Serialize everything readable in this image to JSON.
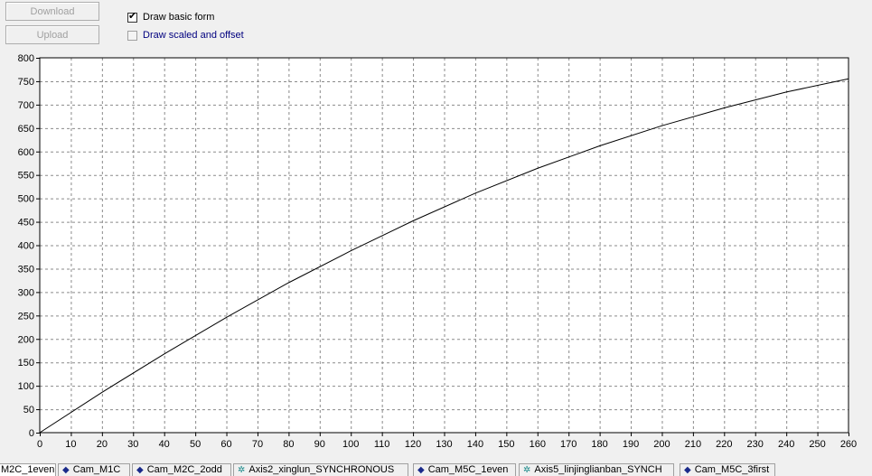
{
  "toolbar": {
    "download_label": "Download",
    "upload_label": "Upload"
  },
  "options": {
    "draw_basic": {
      "label": "Draw basic form",
      "checked": true,
      "check_glyph": "✔"
    },
    "draw_scaled": {
      "label": "Draw scaled and offset",
      "checked": false
    }
  },
  "chart_data": {
    "type": "line",
    "title": "",
    "xlabel": "",
    "ylabel": "",
    "xlim": [
      0,
      260
    ],
    "ylim": [
      0,
      800
    ],
    "x_ticks": [
      0,
      10,
      20,
      30,
      40,
      50,
      60,
      70,
      80,
      90,
      100,
      110,
      120,
      130,
      140,
      150,
      160,
      170,
      180,
      190,
      200,
      210,
      220,
      230,
      240,
      250,
      260
    ],
    "y_ticks": [
      0,
      50,
      100,
      150,
      200,
      250,
      300,
      350,
      400,
      450,
      500,
      550,
      600,
      650,
      700,
      750,
      800
    ],
    "grid": true,
    "series": [
      {
        "color": "#000000",
        "x": [
          0,
          20,
          40,
          60,
          80,
          100,
          120,
          140,
          160,
          180,
          200,
          220,
          240,
          260
        ],
        "y": [
          0,
          86,
          168,
          246,
          320,
          388,
          452,
          511,
          564,
          612,
          655,
          693,
          727,
          755
        ]
      }
    ]
  },
  "tabs": [
    {
      "label": "M2C_1even",
      "icon": ""
    },
    {
      "label": "Cam_M1C",
      "icon": "cam-icon"
    },
    {
      "label": "Cam_M2C_2odd",
      "icon": "cam-icon"
    },
    {
      "label": "Axis2_xinglun_SYNCHRONOUS",
      "icon": "axis-icon"
    },
    {
      "label": "Cam_M5C_1even",
      "icon": "cam-icon"
    },
    {
      "label": "Axis5_linjinglianban_SYNCH",
      "icon": "axis-icon"
    },
    {
      "label": "Cam_M5C_3first",
      "icon": "cam-icon"
    }
  ]
}
